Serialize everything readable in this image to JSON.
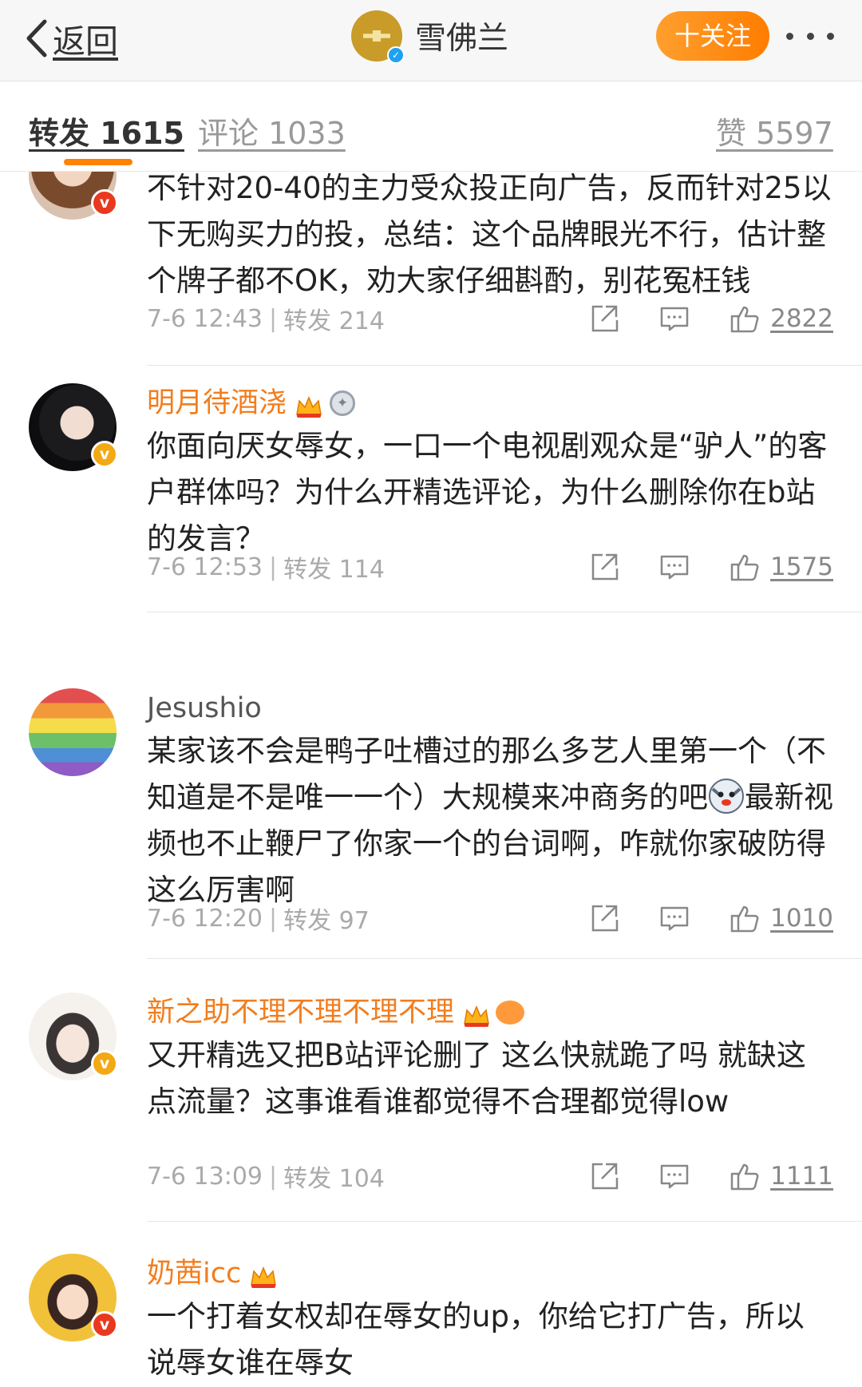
{
  "nav": {
    "back_label": "返回",
    "brand_name": "雪佛兰",
    "follow_label": "十关注"
  },
  "tabs": [
    {
      "label": "转发 1615"
    },
    {
      "label": "评论 1033"
    },
    {
      "label": "赞 5597"
    }
  ],
  "comments": [
    {
      "text": "不针对20-40的主力受众投正向广告，反而针对25以下无购买力的投，总结：这个品牌眼光不行，估计整个牌子都不OK，劝大家仔细斟酌，别花冤枉钱",
      "time": "7-6 12:43",
      "repost": "转发 214",
      "likes": "2822"
    },
    {
      "username": "明月待酒浇",
      "text": "你面向厌女辱女，一口一个电视剧观众是“驴人”的客户群体吗？为什么开精选评论，为什么删除你在b站的发言？",
      "time": "7-6 12:53",
      "repost": "转发 114",
      "likes": "1575"
    },
    {
      "username": "Jesushio",
      "text_a": "某家该不会是鸭子吐槽过的那么多艺人里第一个（不知道是不是唯一一个）大规模来冲商务的吧",
      "text_b": "最新视频也不止鞭尸了你家一个的台词啊，咋就你家破防得这么厉害啊",
      "time": "7-6 12:20",
      "repost": "转发 97",
      "likes": "1010"
    },
    {
      "username": "新之助不理不理不理不理",
      "text": "又开精选又把B站评论删了 这么快就跪了吗 就缺这点流量？这事谁看谁都觉得不合理都觉得low",
      "time": "7-6 13:09",
      "repost": "转发 104",
      "likes": "1111"
    },
    {
      "username": "奶茜icc",
      "text": "一个打着女权却在辱女的up，你给它打广告，所以说辱女谁在辱女"
    }
  ],
  "icons": {
    "brand": "chevrolet-logo",
    "share": "share-icon",
    "comment": "comment-icon",
    "like": "thumbs-up-icon"
  },
  "colors": {
    "accent": "#ff8200",
    "username": "#f27d1d",
    "verified_red": "#e8391f",
    "verified_gold": "#f2a914"
  }
}
